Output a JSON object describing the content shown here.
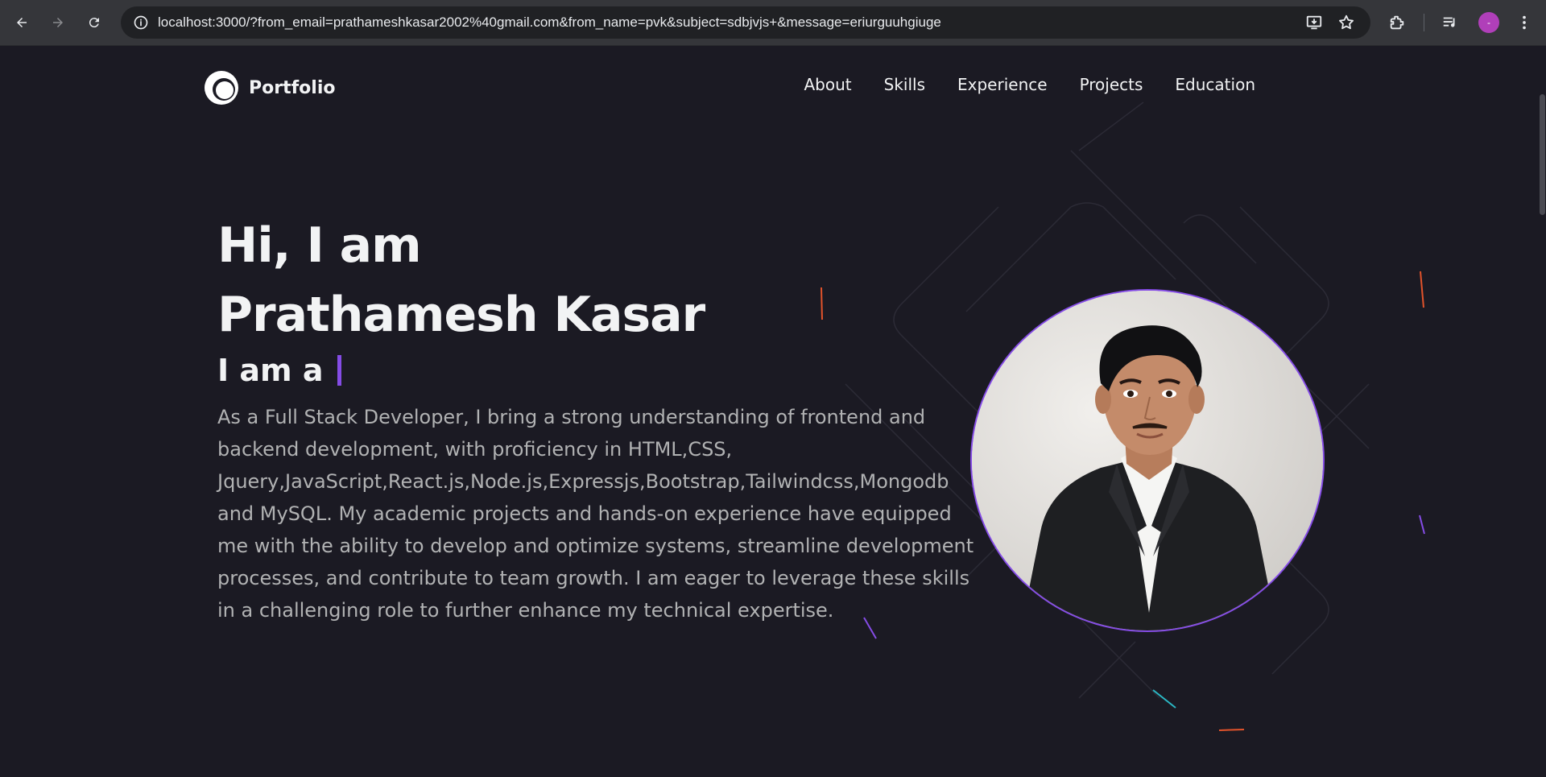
{
  "browser": {
    "url": "localhost:3000/?from_email=prathameshkasar2002%40gmail.com&from_name=pvk&subject=sdbjvjs+&message=eriurguuhgiuge",
    "profile_initial": "-",
    "icons": [
      "back-icon",
      "forward-icon",
      "reload-icon",
      "site-info-icon",
      "install-app-icon",
      "bookmark-star-icon",
      "extensions-icon",
      "media-controls-icon",
      "profile-avatar",
      "menu-kebab-icon"
    ]
  },
  "header": {
    "logo_text": "Portfolio",
    "nav": [
      "About",
      "Skills",
      "Experience",
      "Projects",
      "Education"
    ]
  },
  "hero": {
    "greeting_line1": "Hi, I am",
    "greeting_line2": "Prathamesh Kasar",
    "typing_prefix": "I am a",
    "description": "As a Full Stack Developer, I bring a strong understanding of frontend and backend development, with proficiency in HTML,CSS, Jquery,JavaScript,React.js,Node.js,Expressjs,Bootstrap,Tailwindcss,Mongodb and MySQL. My academic projects and hands-on experience have equipped me with the ability to develop and optimize systems, streamline development processes, and contribute to team growth. I am eager to leverage these skills in a challenging role to further enhance my technical expertise."
  },
  "colors": {
    "background": "#1b1a23",
    "primary": "#854ce6",
    "text_primary": "#f2f3f4",
    "text_secondary": "#b1b2b3",
    "chrome": "#35363a",
    "omnibox": "#202124"
  }
}
